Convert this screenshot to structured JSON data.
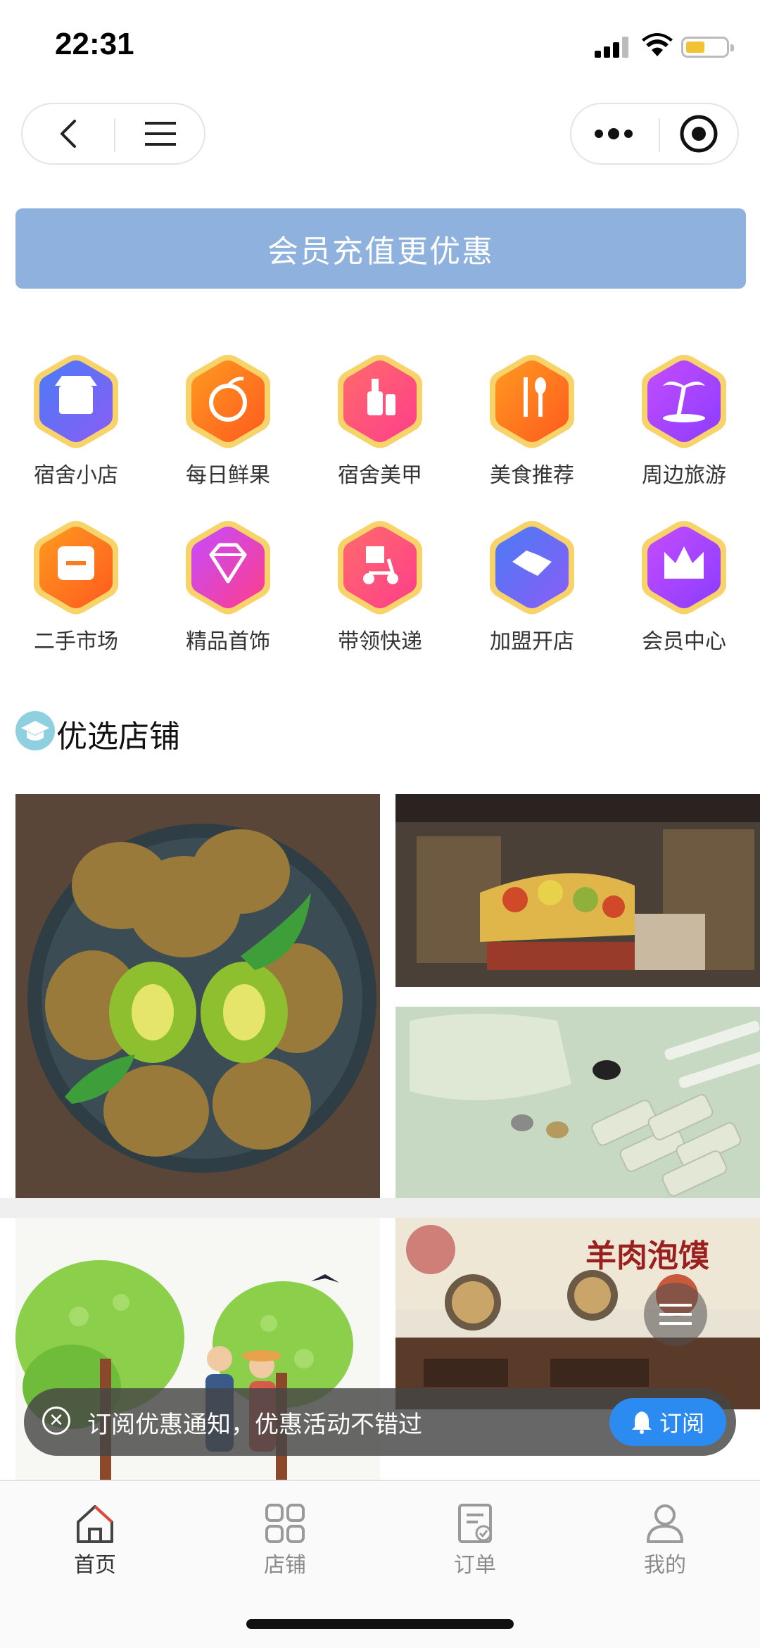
{
  "status": {
    "time": "22:31"
  },
  "banner": {
    "text": "会员充值更优惠"
  },
  "categories": [
    {
      "label": "宿舍小店",
      "icon": "shop-icon",
      "c1": "#4a7cf6",
      "c2": "#8b5cf6"
    },
    {
      "label": "每日鲜果",
      "icon": "orange-icon",
      "c1": "#ff9a1f",
      "c2": "#ff5a1f"
    },
    {
      "label": "宿舍美甲",
      "icon": "nail-polish-icon",
      "c1": "#ff6b6b",
      "c2": "#ff3d8b"
    },
    {
      "label": "美食推荐",
      "icon": "fork-spoon-icon",
      "c1": "#ff9a1f",
      "c2": "#ff5a1f"
    },
    {
      "label": "周边旅游",
      "icon": "palm-tree-icon",
      "c1": "#c44cff",
      "c2": "#8b3dff"
    },
    {
      "label": "二手市场",
      "icon": "exchange-icon",
      "c1": "#ff9a1f",
      "c2": "#ff5a1f"
    },
    {
      "label": "精品首饰",
      "icon": "diamond-icon",
      "c1": "#c44cff",
      "c2": "#ff3d8b"
    },
    {
      "label": "带领快递",
      "icon": "delivery-scooter-icon",
      "c1": "#ff6b6b",
      "c2": "#ff3d8b"
    },
    {
      "label": "加盟开店",
      "icon": "handshake-icon",
      "c1": "#4a7cf6",
      "c2": "#8b5cf6"
    },
    {
      "label": "会员中心",
      "icon": "crown-icon",
      "c1": "#c44cff",
      "c2": "#8b3dff"
    }
  ],
  "section": {
    "title": "优选店铺"
  },
  "stores": {
    "mutton_signboard": "羊肉泡馍"
  },
  "subscribe": {
    "text": "订阅优惠通知，优惠活动不错过",
    "button": "订阅"
  },
  "tabbar": [
    {
      "label": "首页",
      "icon": "home-icon",
      "active": true
    },
    {
      "label": "店铺",
      "icon": "grid-icon",
      "active": false
    },
    {
      "label": "订单",
      "icon": "order-icon",
      "active": false
    },
    {
      "label": "我的",
      "icon": "user-icon",
      "active": false
    }
  ]
}
